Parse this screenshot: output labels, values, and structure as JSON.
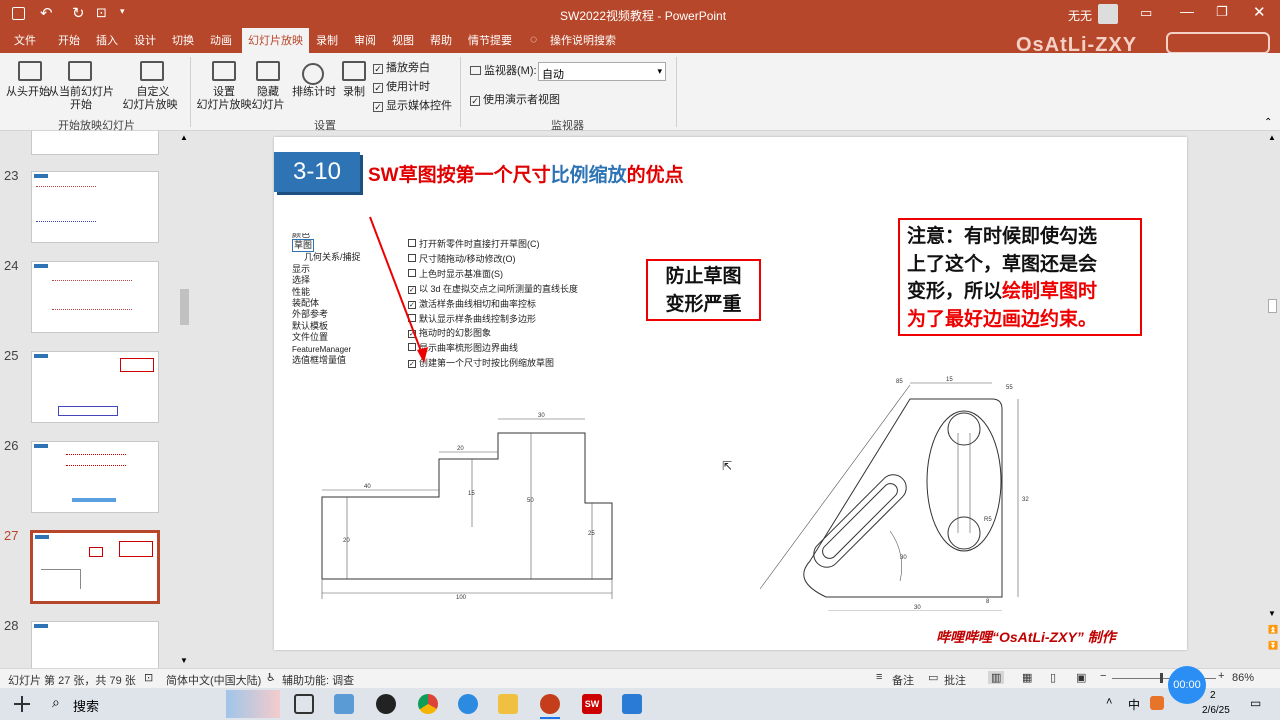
{
  "window": {
    "title": "SW2022视频教程 - PowerPoint",
    "user": "无无",
    "watermark": "OsAtLi-ZXY"
  },
  "tabs": [
    "文件",
    "开始",
    "插入",
    "设计",
    "切换",
    "动画",
    "幻灯片放映",
    "录制",
    "审阅",
    "视图",
    "帮助",
    "情节提要"
  ],
  "active_tab": "幻灯片放映",
  "tell_me": "操作说明搜索",
  "ribbon": {
    "from_start": "从头开始",
    "from_current_1": "从当前幻灯片",
    "from_current_2": "开始",
    "custom_1": "自定义",
    "custom_2": "幻灯片放映",
    "group_start": "开始放映幻灯片",
    "setup_1": "设置",
    "setup_2": "幻灯片放映",
    "hide_1": "隐藏",
    "hide_2": "幻灯片",
    "rehearse": "排练计时",
    "record": "录制",
    "play_narration": "播放旁白",
    "use_timings": "使用计时",
    "show_media": "显示媒体控件",
    "group_setup": "设置",
    "monitor_label": "监视器(M):",
    "monitor_value": "自动",
    "presenter_view": "使用演示者视图",
    "group_monitor": "监视器"
  },
  "thumbnails": [
    {
      "num": "23"
    },
    {
      "num": "24"
    },
    {
      "num": "25"
    },
    {
      "num": "26"
    },
    {
      "num": "27"
    },
    {
      "num": "28"
    }
  ],
  "slide": {
    "number_badge": "3-10",
    "title_a": "SW草图按第一个尺寸",
    "title_b": "比例缩放",
    "title_c": "的优点",
    "tree": [
      "颜色",
      "草图",
      "几何关系/捕捉",
      "显示",
      "选择",
      "性能",
      "装配体",
      "外部参考",
      "默认模板",
      "文件位置",
      "FeatureManager",
      "选值框增量值"
    ],
    "options": [
      {
        "checked": false,
        "text": "打开新零件时直接打开草图(C)"
      },
      {
        "checked": false,
        "text": "尺寸随拖动/移动修改(O)"
      },
      {
        "checked": false,
        "text": "上色时显示基准面(S)"
      },
      {
        "checked": true,
        "text": "以 3d 在虚拟交点之间所测量的直线长度"
      },
      {
        "checked": true,
        "text": "激活样条曲线相切和曲率控标"
      },
      {
        "checked": false,
        "text": "默认显示样条曲线控制多边形"
      },
      {
        "checked": true,
        "text": "拖动时的幻影图象"
      },
      {
        "checked": false,
        "text": "显示曲率梳形图边界曲线"
      },
      {
        "checked": true,
        "text": "创建第一个尺寸时按比例缩放草图"
      }
    ],
    "note_box": "防止草图变形严重",
    "note_box_line1": "防止草图",
    "note_box_line2": "变形严重",
    "notice_1": "注意：有时候即使勾选",
    "notice_2": "上了这个，草图还是会",
    "notice_3a": "变形，所以",
    "notice_3b": "绘制草图时",
    "notice_4": "为了最好边画边约束。",
    "dims_left": [
      "30",
      "20",
      "40",
      "15",
      "50",
      "25",
      "20",
      "100"
    ],
    "dims_right": [
      "15",
      "85",
      "55",
      "32",
      "30",
      "8",
      "R5",
      "30"
    ],
    "credit": "哔哩哔哩“OsAtLi-ZXY” 制作"
  },
  "status": {
    "slide_info": "幻灯片 第 27 张，共 79 张",
    "language": "简体中文(中国大陆)",
    "accessibility": "辅助功能: 调查",
    "notes": "备注",
    "comments": "批注",
    "zoom": "86%"
  },
  "taskbar": {
    "search": "搜索",
    "ime": "中",
    "clock": "00:00",
    "date": "2/6/25",
    "time_partial": "2"
  }
}
